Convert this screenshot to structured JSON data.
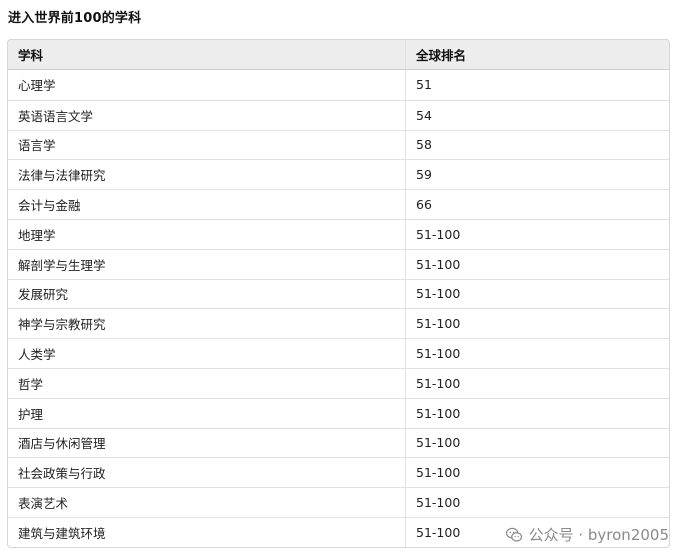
{
  "title": "进入世界前100的学科",
  "table": {
    "headers": [
      "学科",
      "全球排名"
    ],
    "rows": [
      [
        "心理学",
        "51"
      ],
      [
        "英语语言文学",
        "54"
      ],
      [
        "语言学",
        "58"
      ],
      [
        "法律与法律研究",
        "59"
      ],
      [
        "会计与金融",
        "66"
      ],
      [
        "地理学",
        "51-100"
      ],
      [
        "解剖学与生理学",
        "51-100"
      ],
      [
        "发展研究",
        "51-100"
      ],
      [
        "神学与宗教研究",
        "51-100"
      ],
      [
        "人类学",
        "51-100"
      ],
      [
        "哲学",
        "51-100"
      ],
      [
        "护理",
        "51-100"
      ],
      [
        "酒店与休闲管理",
        "51-100"
      ],
      [
        "社会政策与行政",
        "51-100"
      ],
      [
        "表演艺术",
        "51-100"
      ],
      [
        "建筑与建筑环境",
        "51-100"
      ]
    ]
  },
  "watermark": {
    "text": "公众号 · byron2005",
    "icon": "wechat-icon"
  }
}
